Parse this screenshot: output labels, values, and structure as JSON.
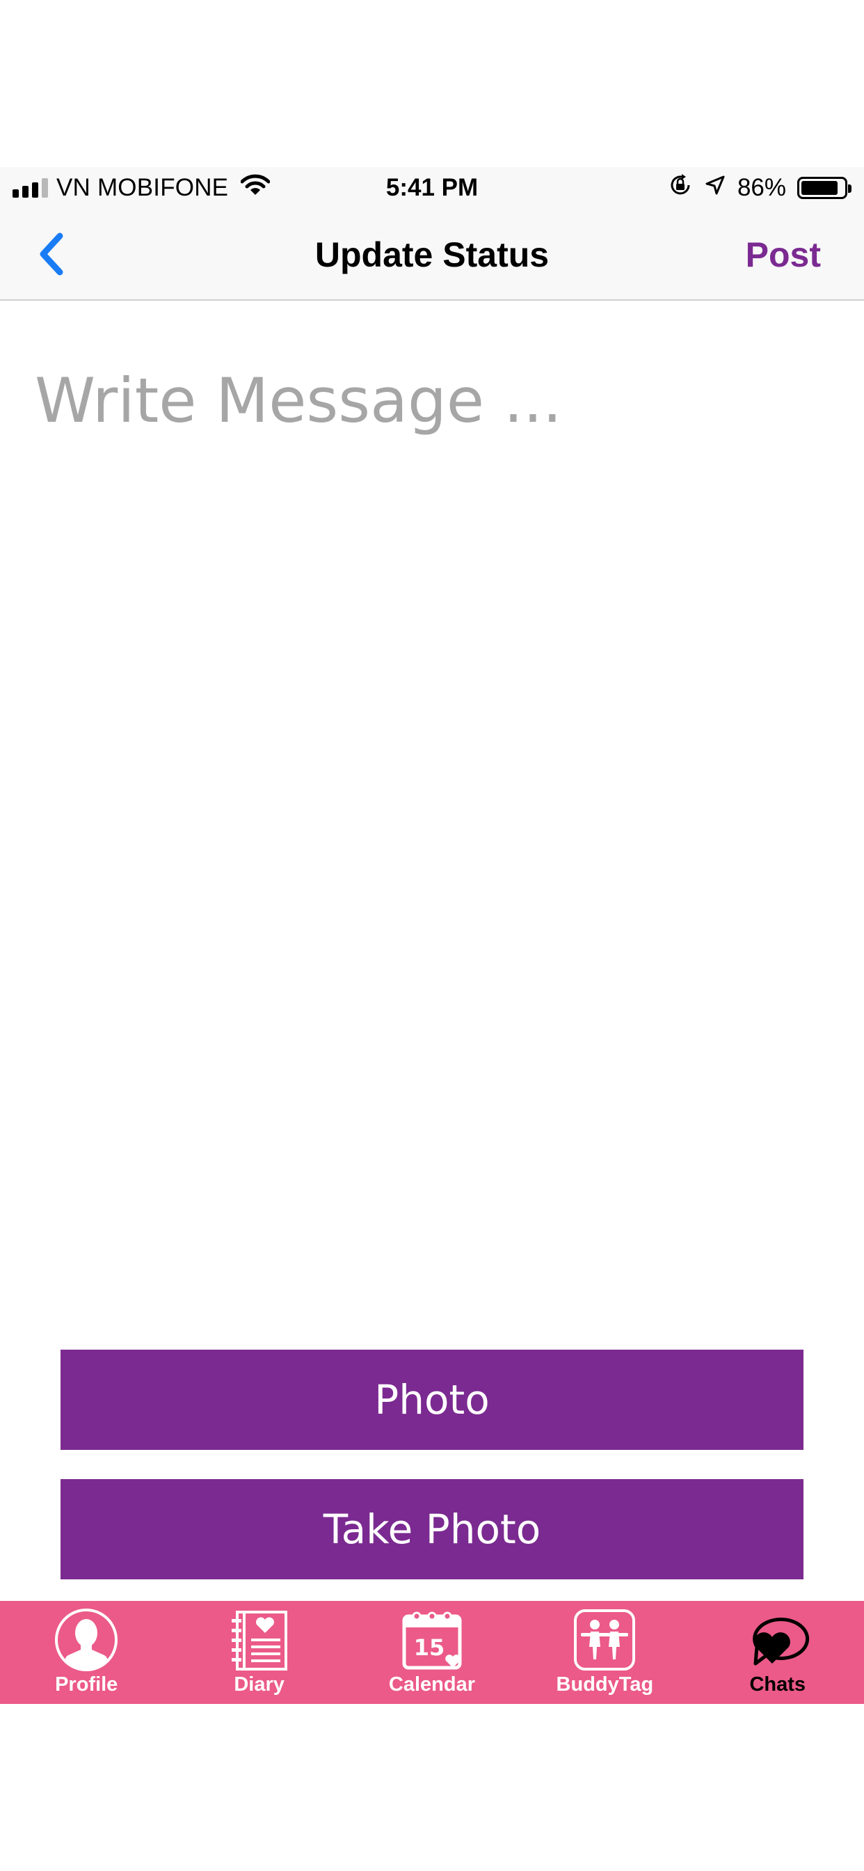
{
  "status_bar": {
    "carrier": "VN MOBIFONE",
    "time": "5:41 PM",
    "battery_percent": "86%",
    "battery_level": 0.86,
    "icons": [
      "signal-icon",
      "wifi-icon",
      "orientation-lock-icon",
      "location-arrow-icon",
      "battery-icon"
    ]
  },
  "nav": {
    "title": "Update Status",
    "post_label": "Post",
    "back_icon": "chevron-left-icon"
  },
  "message": {
    "placeholder": "Write Message ...",
    "value": ""
  },
  "actions": {
    "photo_label": "Photo",
    "take_photo_label": "Take Photo"
  },
  "tabs": [
    {
      "label": "Profile",
      "icon": "profile-icon",
      "active": false
    },
    {
      "label": "Diary",
      "icon": "diary-icon",
      "active": false
    },
    {
      "label": "Calendar",
      "icon": "calendar-icon",
      "active": false,
      "icon_text": "15"
    },
    {
      "label": "BuddyTag",
      "icon": "buddytag-icon",
      "active": false
    },
    {
      "label": "Chats",
      "icon": "chats-icon",
      "active": true
    }
  ],
  "colors": {
    "accent_purple": "#7b2a91",
    "tab_bar_pink": "#eb5a89",
    "back_blue": "#1a7cf5",
    "placeholder_gray": "#a6a6a6"
  }
}
